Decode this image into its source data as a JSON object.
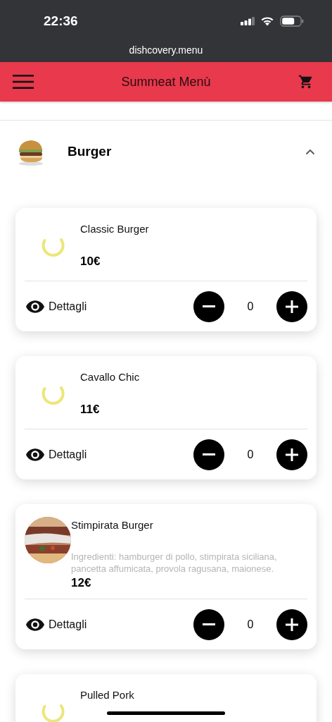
{
  "status_bar": {
    "time": "22:36"
  },
  "browser": {
    "url": "dishcovery.menu"
  },
  "header": {
    "title": "Summeat Menù"
  },
  "category": {
    "name": "Burger",
    "expanded": true
  },
  "dishes": [
    {
      "name": "Classic Burger",
      "kind": "spinner",
      "price": "10€",
      "details": "Dettagli",
      "quantity": "0"
    },
    {
      "name": "Cavallo Chic",
      "kind": "spinner",
      "price": "11€",
      "details": "Dettagli",
      "quantity": "0"
    },
    {
      "name": "Stimpirata Burger",
      "kind": "picture",
      "description": "Ingredienti: hamburger di pollo, stimpirata siciliana, pancetta affumicata, provola ragusana, maionese.",
      "price": "12€",
      "details": "Dettagli",
      "quantity": "0"
    },
    {
      "name": "Pulled Pork",
      "kind": "spinner"
    }
  ]
}
